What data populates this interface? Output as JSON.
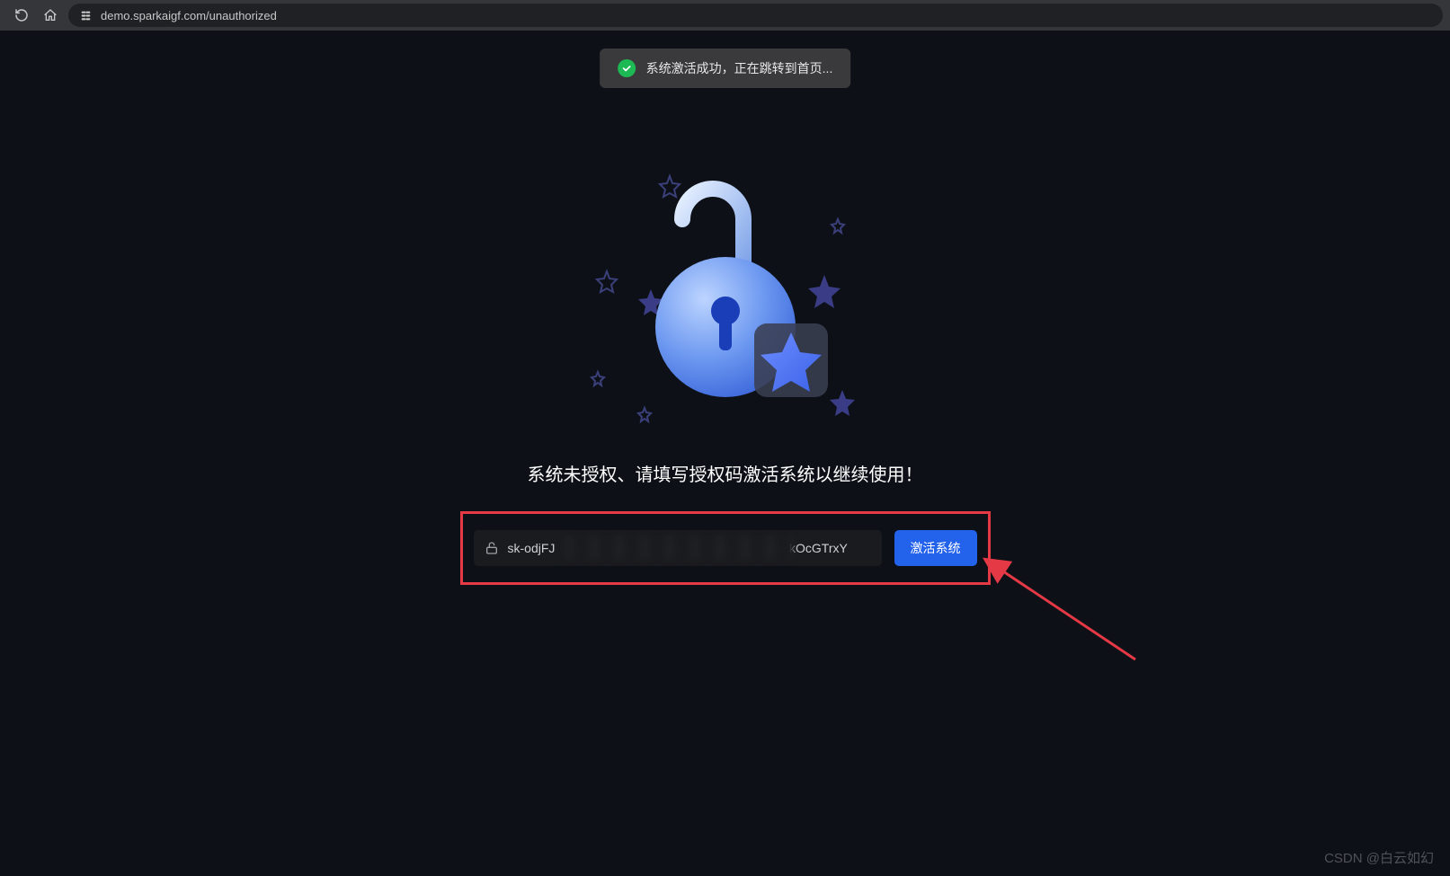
{
  "browser": {
    "url": "demo.sparkaigf.com/unauthorized"
  },
  "toast": {
    "message": "系统激活成功，正在跳转到首页..."
  },
  "page": {
    "heading": "系统未授权、请填写授权码激活系统以继续使用！"
  },
  "form": {
    "license_value": "sk-odjFJ                                                              CXkOcGTrxY",
    "activate_label": "激活系统"
  },
  "watermark": {
    "text": "CSDN @白云如幻"
  }
}
